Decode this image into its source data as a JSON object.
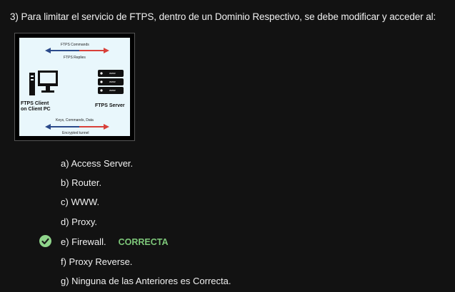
{
  "question": "3) Para limitar el servicio de FTPS, dentro de un Dominio Respectivo, se debe modificar y acceder al:",
  "figure": {
    "ftps_commands": "FTPS Commands",
    "ftps_replies": "FTPS Replies",
    "client_label_line1": "FTPS Client",
    "client_label_line2": "on Client PC",
    "server_label": "FTPS Server",
    "keys_label": "Keys, Commands, Data",
    "tunnel_label": "Encrypted tunnel",
    "server_slot_text": "www",
    "arrow_colors": {
      "left": "#2b4a8a",
      "right": "#d8403a"
    }
  },
  "options": [
    {
      "label": "a) Access Server."
    },
    {
      "label": "b) Router."
    },
    {
      "label": "c) WWW."
    },
    {
      "label": "d) Proxy."
    },
    {
      "label": "e) Firewall.",
      "status": "CORRECTA"
    },
    {
      "label": "f) Proxy Reverse."
    },
    {
      "label": "g) Ninguna de las Anteriores es Correcta."
    }
  ],
  "correct_icon": "check-circle-icon",
  "colors": {
    "correct": "#7ec87a",
    "background": "#121212"
  }
}
